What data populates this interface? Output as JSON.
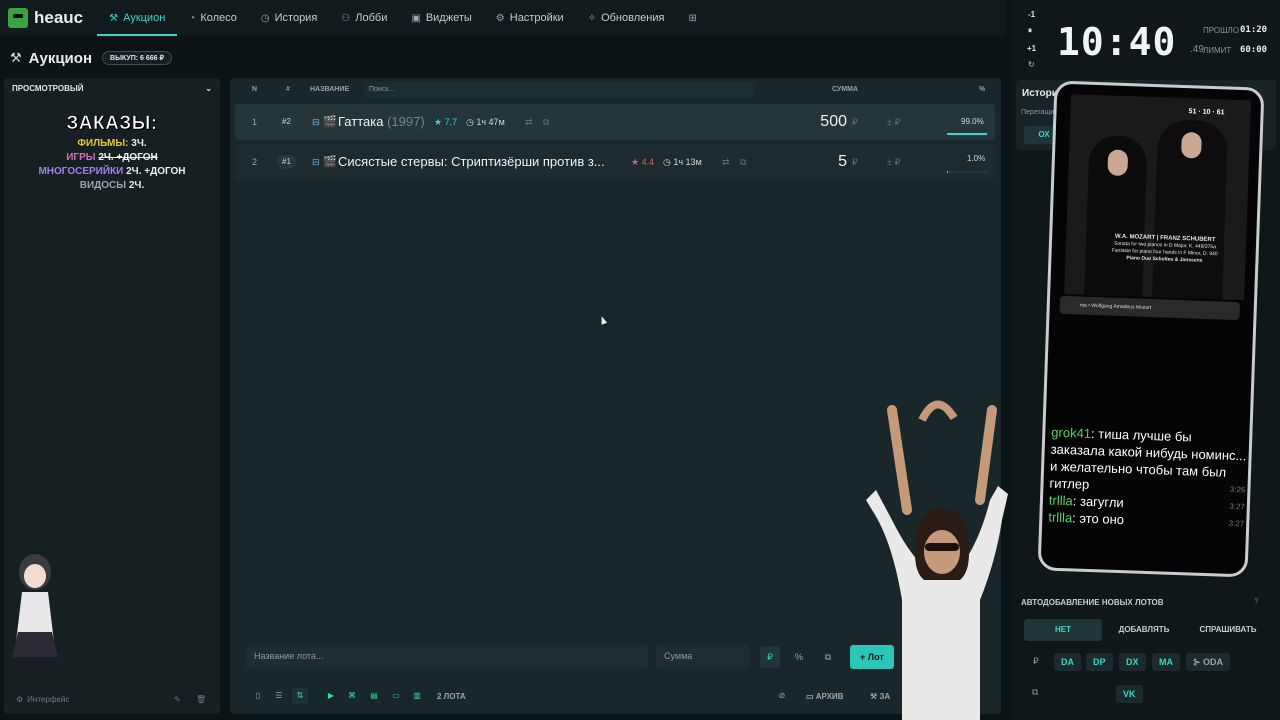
{
  "app": {
    "name": "heauc"
  },
  "nav": [
    {
      "label": "Аукцион",
      "icon": "hammer-icon",
      "active": true
    },
    {
      "label": "Колесо",
      "icon": "wheel-icon"
    },
    {
      "label": "История",
      "icon": "history-icon"
    },
    {
      "label": "Лобби",
      "icon": "users-icon"
    },
    {
      "label": "Виджеты",
      "icon": "widget-icon"
    },
    {
      "label": "Настройки",
      "icon": "gear-icon"
    },
    {
      "label": "Обновления",
      "icon": "sparkle-icon"
    }
  ],
  "page": {
    "title": "Аукцион",
    "buyout_badge": "ВЫКУП: 6 666 ₽"
  },
  "left": {
    "header": "ПРОСМОТРОВЫЙ",
    "orders_title": "ЗАКАЗЫ:",
    "lines": [
      {
        "a": "ФИЛЬМЫ:",
        "b": "3Ч."
      },
      {
        "a": "ИГРЫ",
        "b": "2Ч. +ДОГОН"
      },
      {
        "a": "МНОГОСЕРИЙКИ",
        "b": "2Ч. +ДОГОН"
      },
      {
        "a": "ВИДОСЫ",
        "b": "2Ч."
      }
    ],
    "footer": "Интерфейс"
  },
  "table": {
    "headers": {
      "n": "N",
      "hash": "#",
      "name": "НАЗВАНИЕ",
      "search_placeholder": "Поиск...",
      "sum": "СУММА",
      "pct": "%"
    },
    "rows": [
      {
        "n": "1",
        "id": "#2",
        "title": "Гаттака",
        "year": "(1997)",
        "rating": "7.7",
        "duration": "1ч 47м",
        "sum": "500",
        "currency": "₽",
        "pct": "99.0%",
        "pct_value": 0.99
      },
      {
        "n": "2",
        "id": "#1",
        "title": "Сисястые стервы: Стриптизёрши против з...",
        "year": "",
        "rating": "4.4",
        "duration": "1ч 13м",
        "sum": "5",
        "currency": "₽",
        "pct": "1.0%",
        "pct_value": 0.01
      }
    ]
  },
  "add": {
    "name_placeholder": "Название лота...",
    "sum_placeholder": "Сумма",
    "cur_rub": "₽",
    "cur_pct": "%",
    "add_label": "+ Лот"
  },
  "bottom": {
    "lots_count": "2 ЛОТА",
    "archive": "АРХИВ",
    "z": "ЗА"
  },
  "timer": {
    "minus": "-1",
    "plus": "+1",
    "time": "10:40",
    "ms": ".49",
    "passed_label": "ПРОШЛО",
    "passed": "01:20",
    "limit_label": "ЛИМИТ",
    "limit": "60:00"
  },
  "donations": {
    "title": "История донатов",
    "sub": "Перетащите",
    "btn": "ОХ"
  },
  "autoadd": {
    "title": "АВТОДОБАВЛЕНИЕ НОВЫХ ЛОТОВ",
    "options": [
      "НЕТ",
      "ДОБАВЛЯТЬ",
      "СПРАШИВАТЬ"
    ],
    "chips": [
      "DA",
      "DP",
      "DX",
      "MA",
      "ODA"
    ],
    "chips2": [
      "VK"
    ]
  },
  "overlay": {
    "counters": [
      "51",
      "10",
      "61"
    ],
    "album_line1": "W.A. MOZART | FRANZ SCHUBERT",
    "album_line2": "Sonata for two pianos in D Major, K. 448/375a",
    "album_line3": "Fantasie for piano four hands in F Minor, D. 940",
    "album_line4": "Piano Duo Scholtes & Janssens",
    "now_playing": "nta • Wolfgang Amadeus Mozart",
    "chat": [
      {
        "nick": "grok41",
        "text": ": тиша лучше бы заказала какой нибудь номинс... и желательно чтобы там был гитлер",
        "time": "3:26"
      },
      {
        "nick": "trllla",
        "text": ": загугли",
        "time": "3:27"
      },
      {
        "nick": "trllla",
        "text": ": это оно",
        "time": "3:27"
      }
    ]
  }
}
